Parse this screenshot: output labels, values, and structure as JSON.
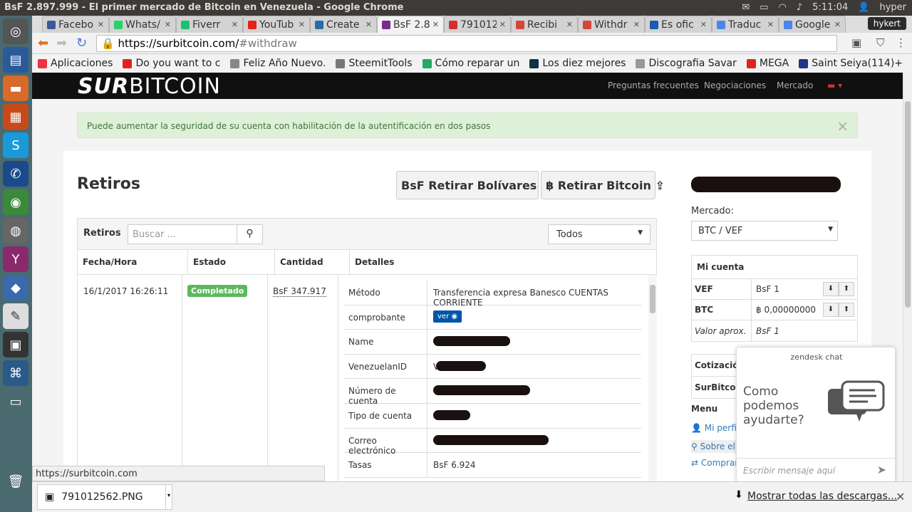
{
  "os": {
    "window_title": "BsF 2.897.999 - El primer mercado de Bitcoin en Venezuela - Google Chrome",
    "clock": "5:11:04",
    "user": "hyper"
  },
  "browser": {
    "profile": "hykert",
    "tabs": [
      {
        "label": "Facebo",
        "color": "#3b5998"
      },
      {
        "label": "Whats/",
        "color": "#25d366"
      },
      {
        "label": "Fiverr",
        "color": "#1dbf73"
      },
      {
        "label": "YouTub",
        "color": "#e62117"
      },
      {
        "label": "Create",
        "color": "#2c6aa8"
      },
      {
        "label": "BsF 2.8",
        "color": "#7a2a8a",
        "active": true
      },
      {
        "label": "791012",
        "color": "#d03030"
      },
      {
        "label": "Recibi",
        "color": "#d44638"
      },
      {
        "label": "Withdr",
        "color": "#d44638"
      },
      {
        "label": "Es ofic",
        "color": "#1b5bb0"
      },
      {
        "label": "Traduc",
        "color": "#4a86e8"
      },
      {
        "label": "Google",
        "color": "#4a86e8"
      }
    ],
    "url_host": "https://surbitcoin.com/",
    "url_path": "#withdraw",
    "bookmarks": [
      {
        "label": "Aplicaciones",
        "color": "#e34"
      },
      {
        "label": "Do you want to c",
        "color": "#d22"
      },
      {
        "label": "Feliz Año Nuevo.",
        "color": "#888"
      },
      {
        "label": "SteemitTools",
        "color": "#777"
      },
      {
        "label": "Cómo reparar un",
        "color": "#2a6"
      },
      {
        "label": "Los diez mejores",
        "color": "#134"
      },
      {
        "label": "Discografia Savar",
        "color": "#999"
      },
      {
        "label": "MEGA",
        "color": "#d22"
      },
      {
        "label": "Saint Seiya(114)+",
        "color": "#238"
      }
    ]
  },
  "site": {
    "logo_a": "SUR",
    "logo_b": "BITCOIN",
    "nav": [
      "Preguntas frecuentes",
      "Negociaciones",
      "Mercado"
    ],
    "alert": "Puede aumentar la seguridad de su cuenta con habilitación de la autentificación en dos pasos",
    "title": "Retiros",
    "btn_bolivares": "BsF Retirar Bolívares",
    "btn_bitcoin": "฿ Retirar Bitcoin",
    "panel_label": "Retiros",
    "search_placeholder": "Buscar ...",
    "filter": "Todos",
    "columns": [
      "Fecha/Hora",
      "Estado",
      "Cantidad",
      "Detalles"
    ],
    "row": {
      "fecha": "16/1/2017 16:26:11",
      "estado": "Completado",
      "cantidad": "BsF 347.917"
    },
    "details": [
      {
        "k": "Método",
        "v": "Transferencia expresa Banesco CUENTAS CORRIENTE"
      },
      {
        "k": "comprobante",
        "v": "ver"
      },
      {
        "k": "Name",
        "v": ""
      },
      {
        "k": "VenezuelanID",
        "v": "V"
      },
      {
        "k": "Número de cuenta",
        "v": ""
      },
      {
        "k": "Tipo de cuenta",
        "v": ""
      },
      {
        "k": "Correo electrónico",
        "v": ""
      },
      {
        "k": "Tasas",
        "v": "BsF 6.924"
      }
    ],
    "mercado_label": "Mercado:",
    "mercado_value": "BTC / VEF",
    "cuenta_title": "Mi cuenta",
    "cuenta": [
      {
        "k": "VEF",
        "v": "BsF 1"
      },
      {
        "k": "BTC",
        "v": "฿ 0,00000000"
      },
      {
        "k": "Valor aprox.",
        "v": "BsF 1"
      }
    ],
    "cotizacion": "Cotización",
    "cotizacion_row": "SurBitcoin",
    "menu_title": "Menu",
    "menu": [
      "Mi perfil",
      "Sobre el",
      "Comprar"
    ]
  },
  "chat": {
    "brand": "zendesk chat",
    "question": "Como podemos ayudarte?",
    "input_placeholder": "Escribir mensaje aquí"
  },
  "status_url": "https://surbitcoin.com",
  "download": {
    "file": "791012562.PNG",
    "show_all": "Mostrar todas las descargas..."
  }
}
